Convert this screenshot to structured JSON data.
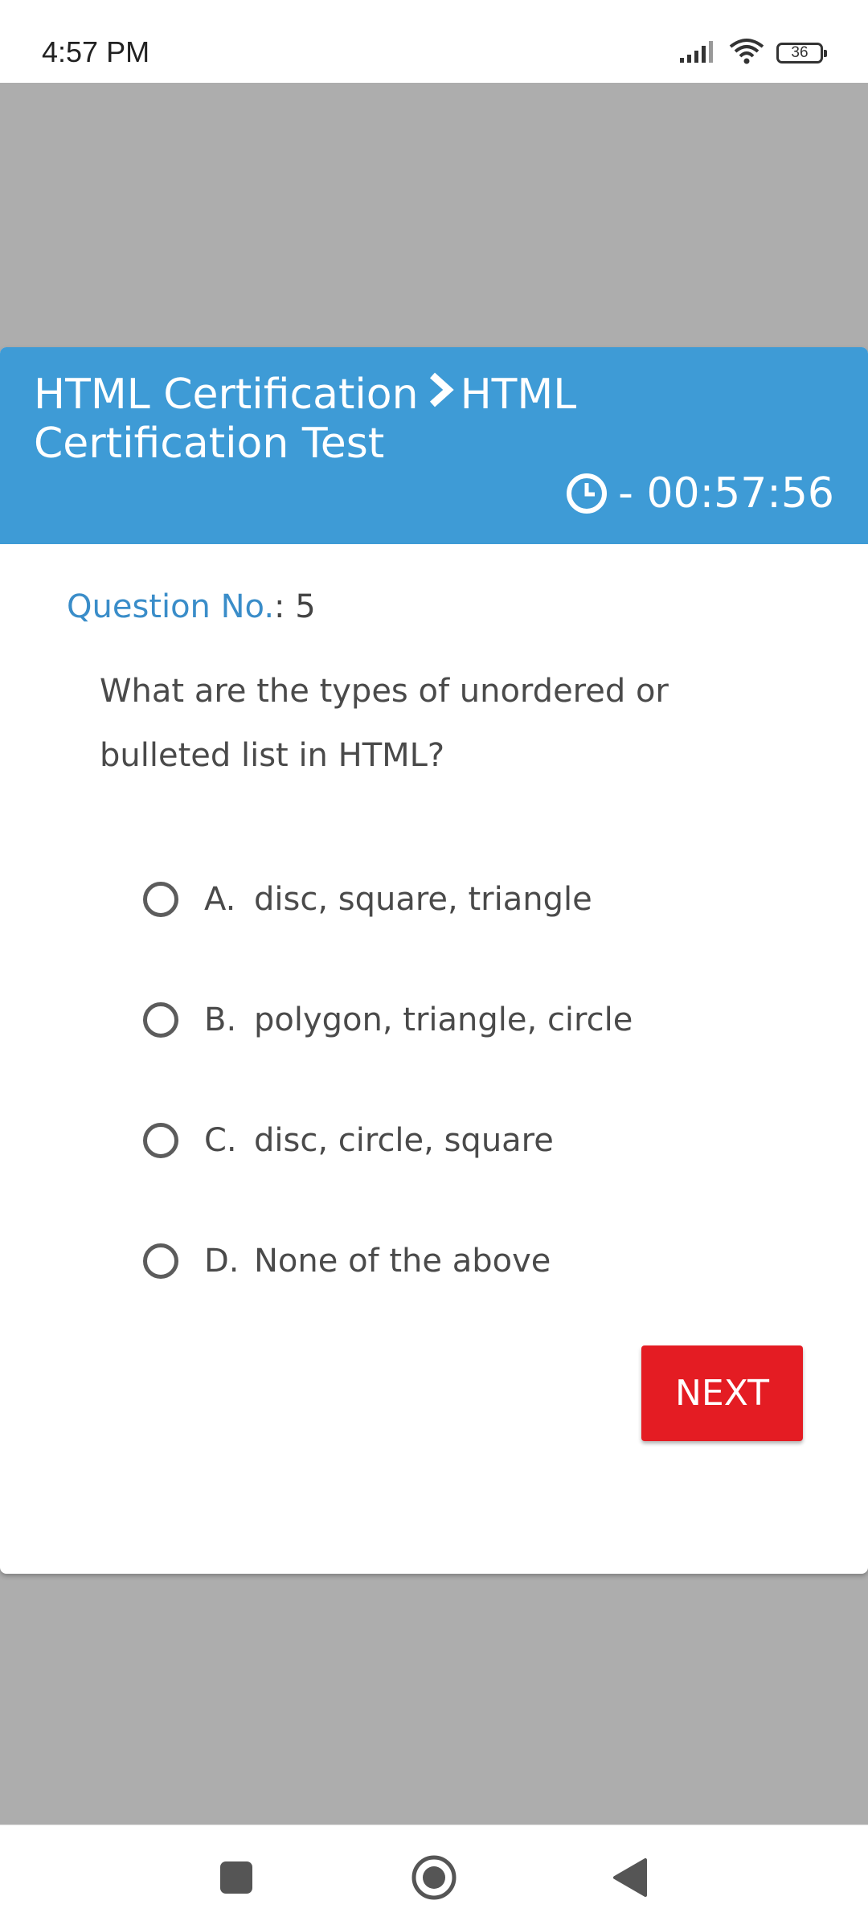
{
  "status_bar": {
    "time": "4:57 PM",
    "battery": "36",
    "icons": [
      "signal-icon",
      "wifi-icon",
      "battery-icon"
    ]
  },
  "header": {
    "crumb_parent": "HTML Certification",
    "crumb_current": "HTML Certification Test",
    "separator_icon": "chevron-right-icon",
    "timer": "- 00:57:56",
    "timer_icon": "clock-icon"
  },
  "question": {
    "label": "Question No.",
    "colon": ":",
    "number": "5",
    "text": "What are the types of unordered or bulleted list in HTML?"
  },
  "options": [
    {
      "letter": "A.",
      "text": "disc, square, triangle",
      "selected": false
    },
    {
      "letter": "B.",
      "text": "polygon, triangle, circle",
      "selected": false
    },
    {
      "letter": "C.",
      "text": "disc, circle, square",
      "selected": false
    },
    {
      "letter": "D.",
      "text": "None of the above",
      "selected": false
    }
  ],
  "actions": {
    "next_label": "NEXT"
  },
  "nav_bar": {
    "icons": [
      "recents-icon",
      "home-icon",
      "back-icon"
    ]
  },
  "colors": {
    "header_bg": "#3e9bd6",
    "question_label": "#3a8dc9",
    "next_button": "#e41c23",
    "backdrop": "#adadad"
  }
}
